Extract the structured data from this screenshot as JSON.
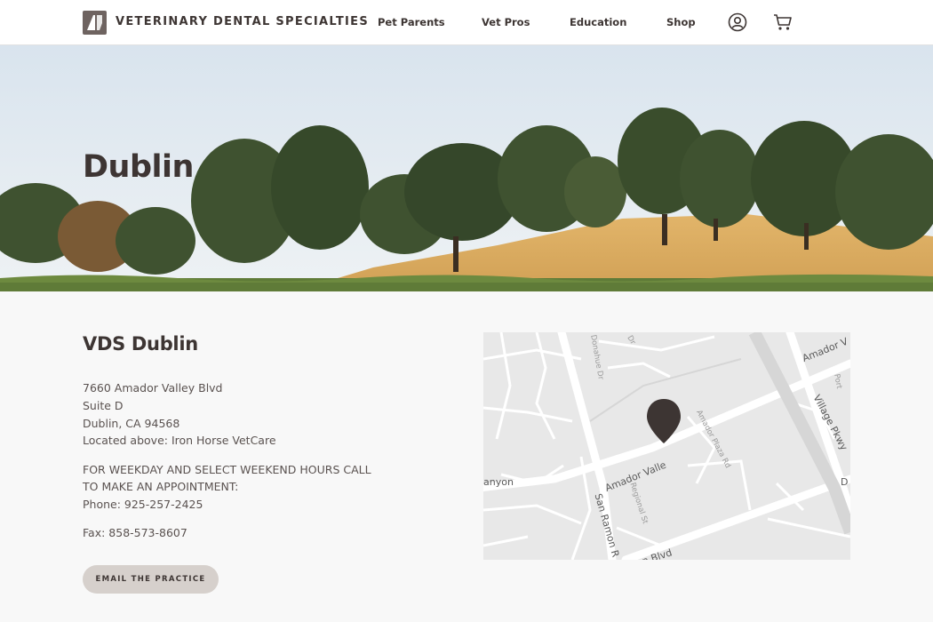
{
  "header": {
    "brand": "VETERINARY DENTAL SPECIALTIES",
    "nav": [
      "Pet Parents",
      "Vet Pros",
      "Education",
      "Shop"
    ],
    "icons": [
      "account-icon",
      "cart-icon"
    ]
  },
  "hero": {
    "title": "Dublin"
  },
  "practice": {
    "name": "VDS Dublin",
    "address": [
      "7660 Amador Valley Blvd",
      "Suite D",
      "Dublin, CA 94568",
      "Located above: Iron Horse VetCare"
    ],
    "hours_note": [
      "FOR WEEKDAY AND SELECT WEEKEND HOURS CALL",
      "TO MAKE AN APPOINTMENT:"
    ],
    "phone": "Phone: 925-257-2425",
    "fax": "Fax: 858-573-8607",
    "email_button": "EMAIL THE PRACTICE"
  },
  "map": {
    "labels": {
      "amador_valley_top": "Amador V",
      "amador_valley": "Amador Valle",
      "village_pkwy": "Village Pkwy",
      "san_ramon": "San Ramon R",
      "canyon": "anyon",
      "blvd": "n Blvd",
      "d_edge": "D",
      "amador_plaza": "Amador Plaza Rd",
      "regional": "Regional St",
      "donahue": "Donahue Dr",
      "dr_top": "Dr",
      "porter": "Port"
    },
    "colors": {
      "marker": "#3d3533",
      "road": "#ffffff",
      "land": "#e8e8e8"
    }
  }
}
